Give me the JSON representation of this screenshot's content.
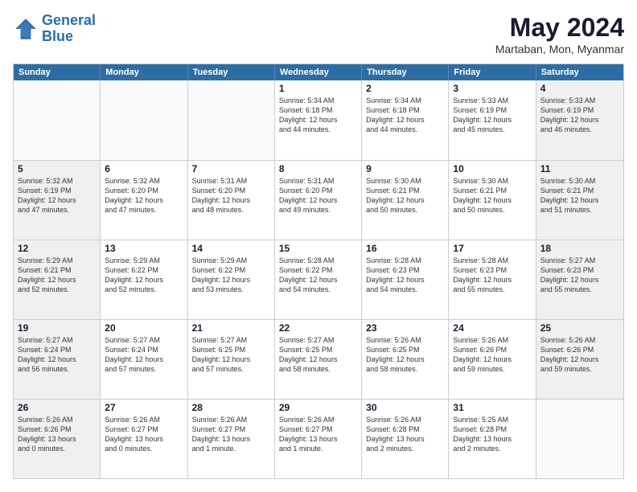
{
  "logo": {
    "line1": "General",
    "line2": "Blue"
  },
  "header": {
    "month": "May 2024",
    "location": "Martaban, Mon, Myanmar"
  },
  "weekdays": [
    "Sunday",
    "Monday",
    "Tuesday",
    "Wednesday",
    "Thursday",
    "Friday",
    "Saturday"
  ],
  "weeks": [
    [
      {
        "day": "",
        "info": [],
        "empty": true
      },
      {
        "day": "",
        "info": [],
        "empty": true
      },
      {
        "day": "",
        "info": [],
        "empty": true
      },
      {
        "day": "1",
        "info": [
          "Sunrise: 5:34 AM",
          "Sunset: 6:18 PM",
          "Daylight: 12 hours",
          "and 44 minutes."
        ],
        "empty": false
      },
      {
        "day": "2",
        "info": [
          "Sunrise: 5:34 AM",
          "Sunset: 6:18 PM",
          "Daylight: 12 hours",
          "and 44 minutes."
        ],
        "empty": false
      },
      {
        "day": "3",
        "info": [
          "Sunrise: 5:33 AM",
          "Sunset: 6:19 PM",
          "Daylight: 12 hours",
          "and 45 minutes."
        ],
        "empty": false
      },
      {
        "day": "4",
        "info": [
          "Sunrise: 5:33 AM",
          "Sunset: 6:19 PM",
          "Daylight: 12 hours",
          "and 46 minutes."
        ],
        "empty": false
      }
    ],
    [
      {
        "day": "5",
        "info": [
          "Sunrise: 5:32 AM",
          "Sunset: 6:19 PM",
          "Daylight: 12 hours",
          "and 47 minutes."
        ],
        "empty": false
      },
      {
        "day": "6",
        "info": [
          "Sunrise: 5:32 AM",
          "Sunset: 6:20 PM",
          "Daylight: 12 hours",
          "and 47 minutes."
        ],
        "empty": false
      },
      {
        "day": "7",
        "info": [
          "Sunrise: 5:31 AM",
          "Sunset: 6:20 PM",
          "Daylight: 12 hours",
          "and 48 minutes."
        ],
        "empty": false
      },
      {
        "day": "8",
        "info": [
          "Sunrise: 5:31 AM",
          "Sunset: 6:20 PM",
          "Daylight: 12 hours",
          "and 49 minutes."
        ],
        "empty": false
      },
      {
        "day": "9",
        "info": [
          "Sunrise: 5:30 AM",
          "Sunset: 6:21 PM",
          "Daylight: 12 hours",
          "and 50 minutes."
        ],
        "empty": false
      },
      {
        "day": "10",
        "info": [
          "Sunrise: 5:30 AM",
          "Sunset: 6:21 PM",
          "Daylight: 12 hours",
          "and 50 minutes."
        ],
        "empty": false
      },
      {
        "day": "11",
        "info": [
          "Sunrise: 5:30 AM",
          "Sunset: 6:21 PM",
          "Daylight: 12 hours",
          "and 51 minutes."
        ],
        "empty": false
      }
    ],
    [
      {
        "day": "12",
        "info": [
          "Sunrise: 5:29 AM",
          "Sunset: 6:21 PM",
          "Daylight: 12 hours",
          "and 52 minutes."
        ],
        "empty": false
      },
      {
        "day": "13",
        "info": [
          "Sunrise: 5:29 AM",
          "Sunset: 6:22 PM",
          "Daylight: 12 hours",
          "and 52 minutes."
        ],
        "empty": false
      },
      {
        "day": "14",
        "info": [
          "Sunrise: 5:29 AM",
          "Sunset: 6:22 PM",
          "Daylight: 12 hours",
          "and 53 minutes."
        ],
        "empty": false
      },
      {
        "day": "15",
        "info": [
          "Sunrise: 5:28 AM",
          "Sunset: 6:22 PM",
          "Daylight: 12 hours",
          "and 54 minutes."
        ],
        "empty": false
      },
      {
        "day": "16",
        "info": [
          "Sunrise: 5:28 AM",
          "Sunset: 6:23 PM",
          "Daylight: 12 hours",
          "and 54 minutes."
        ],
        "empty": false
      },
      {
        "day": "17",
        "info": [
          "Sunrise: 5:28 AM",
          "Sunset: 6:23 PM",
          "Daylight: 12 hours",
          "and 55 minutes."
        ],
        "empty": false
      },
      {
        "day": "18",
        "info": [
          "Sunrise: 5:27 AM",
          "Sunset: 6:23 PM",
          "Daylight: 12 hours",
          "and 55 minutes."
        ],
        "empty": false
      }
    ],
    [
      {
        "day": "19",
        "info": [
          "Sunrise: 5:27 AM",
          "Sunset: 6:24 PM",
          "Daylight: 12 hours",
          "and 56 minutes."
        ],
        "empty": false
      },
      {
        "day": "20",
        "info": [
          "Sunrise: 5:27 AM",
          "Sunset: 6:24 PM",
          "Daylight: 12 hours",
          "and 57 minutes."
        ],
        "empty": false
      },
      {
        "day": "21",
        "info": [
          "Sunrise: 5:27 AM",
          "Sunset: 6:25 PM",
          "Daylight: 12 hours",
          "and 57 minutes."
        ],
        "empty": false
      },
      {
        "day": "22",
        "info": [
          "Sunrise: 5:27 AM",
          "Sunset: 6:25 PM",
          "Daylight: 12 hours",
          "and 58 minutes."
        ],
        "empty": false
      },
      {
        "day": "23",
        "info": [
          "Sunrise: 5:26 AM",
          "Sunset: 6:25 PM",
          "Daylight: 12 hours",
          "and 58 minutes."
        ],
        "empty": false
      },
      {
        "day": "24",
        "info": [
          "Sunrise: 5:26 AM",
          "Sunset: 6:26 PM",
          "Daylight: 12 hours",
          "and 59 minutes."
        ],
        "empty": false
      },
      {
        "day": "25",
        "info": [
          "Sunrise: 5:26 AM",
          "Sunset: 6:26 PM",
          "Daylight: 12 hours",
          "and 59 minutes."
        ],
        "empty": false
      }
    ],
    [
      {
        "day": "26",
        "info": [
          "Sunrise: 5:26 AM",
          "Sunset: 6:26 PM",
          "Daylight: 13 hours",
          "and 0 minutes."
        ],
        "empty": false
      },
      {
        "day": "27",
        "info": [
          "Sunrise: 5:26 AM",
          "Sunset: 6:27 PM",
          "Daylight: 13 hours",
          "and 0 minutes."
        ],
        "empty": false
      },
      {
        "day": "28",
        "info": [
          "Sunrise: 5:26 AM",
          "Sunset: 6:27 PM",
          "Daylight: 13 hours",
          "and 1 minute."
        ],
        "empty": false
      },
      {
        "day": "29",
        "info": [
          "Sunrise: 5:26 AM",
          "Sunset: 6:27 PM",
          "Daylight: 13 hours",
          "and 1 minute."
        ],
        "empty": false
      },
      {
        "day": "30",
        "info": [
          "Sunrise: 5:26 AM",
          "Sunset: 6:28 PM",
          "Daylight: 13 hours",
          "and 2 minutes."
        ],
        "empty": false
      },
      {
        "day": "31",
        "info": [
          "Sunrise: 5:25 AM",
          "Sunset: 6:28 PM",
          "Daylight: 13 hours",
          "and 2 minutes."
        ],
        "empty": false
      },
      {
        "day": "",
        "info": [],
        "empty": true
      }
    ]
  ]
}
